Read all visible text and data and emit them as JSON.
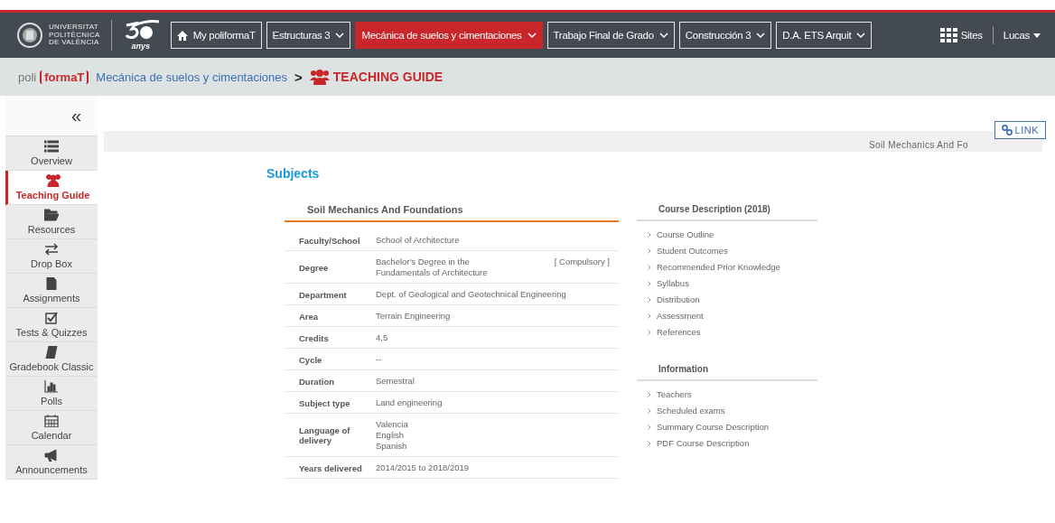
{
  "logo": {
    "university": [
      "UNIVERSITAT",
      "POLITÈCNICA",
      "DE VALÈNCIA"
    ],
    "anniversary": "anys"
  },
  "nav_tabs": [
    {
      "label": "My poliformaT",
      "kind": "home",
      "selected": false
    },
    {
      "label": "Estructuras 3",
      "kind": "dropdown",
      "selected": false
    },
    {
      "label": "Mecánica de suelos y cimentaciones",
      "kind": "dropdown",
      "selected": true
    },
    {
      "label": "Trabajo Final de Grado",
      "kind": "dropdown",
      "selected": false
    },
    {
      "label": "Construcción 3",
      "kind": "dropdown",
      "selected": false
    },
    {
      "label": "D.A. ETS Arquit",
      "kind": "dropdown",
      "selected": false
    }
  ],
  "sites": "Sites",
  "user": "Lucas",
  "breadcrumb": {
    "brand_prefix": "poli",
    "brand_name": "formaT",
    "course": "Mecánica de suelos y cimentaciones",
    "separator": ">",
    "page": "TEACHING GUIDE"
  },
  "sidebar": {
    "collapse": "«",
    "items": [
      {
        "label": "Overview",
        "kind": "list",
        "selected": false
      },
      {
        "label": "Teaching Guide",
        "kind": "people",
        "selected": true
      },
      {
        "label": "Resources",
        "kind": "folder",
        "selected": false
      },
      {
        "label": "Drop Box",
        "kind": "arrows",
        "selected": false
      },
      {
        "label": "Assignments",
        "kind": "file",
        "selected": false
      },
      {
        "label": "Tests & Quizzes",
        "kind": "check",
        "selected": false
      },
      {
        "label": "Gradebook Classic",
        "kind": "book",
        "selected": false
      },
      {
        "label": "Polls",
        "kind": "chart",
        "selected": false
      },
      {
        "label": "Calendar",
        "kind": "calendar",
        "selected": false
      },
      {
        "label": "Announcements",
        "kind": "megaphone",
        "selected": false
      }
    ]
  },
  "link_button": "LINK",
  "banner": "Soil Mechanics And Fo",
  "heading": "Subjects",
  "subject": {
    "title": "Soil Mechanics And Foundations",
    "rows": [
      {
        "label": "Faculty/School",
        "values": [
          "School of Architecture"
        ]
      },
      {
        "label": "Degree",
        "values": [
          "Bachelor's Degree in the",
          "Fundamentals of Architecture"
        ],
        "note": "[ Compulsory ]"
      },
      {
        "label": "Department",
        "values": [
          "Dept. of Geological and Geotechnical Engineering"
        ]
      },
      {
        "label": "Area",
        "values": [
          "Terrain Engineering"
        ]
      },
      {
        "label": "Credits",
        "values": [
          "4,5"
        ]
      },
      {
        "label": "Cycle",
        "values": [
          "--"
        ]
      },
      {
        "label": "Duration",
        "values": [
          "Semestral"
        ]
      },
      {
        "label": "Subject type",
        "values": [
          "Land engineering"
        ]
      },
      {
        "label": "Language of delivery",
        "values": [
          "Valencia",
          "English",
          "Spanish"
        ]
      },
      {
        "label": "Years delivered",
        "values": [
          "2014/2015 to 2018/2019"
        ]
      }
    ]
  },
  "sections": [
    {
      "title": "Course Description (2018)",
      "links": [
        "Course Outline",
        "Student Outcomes",
        "Recommended Prior Knowledge",
        "Syllabus",
        "Distribution",
        "Assessment",
        "References"
      ]
    },
    {
      "title": "Information",
      "links": [
        "Teachers",
        "Scheduled exams",
        "Summary Course Description",
        "PDF Course Description"
      ]
    }
  ]
}
